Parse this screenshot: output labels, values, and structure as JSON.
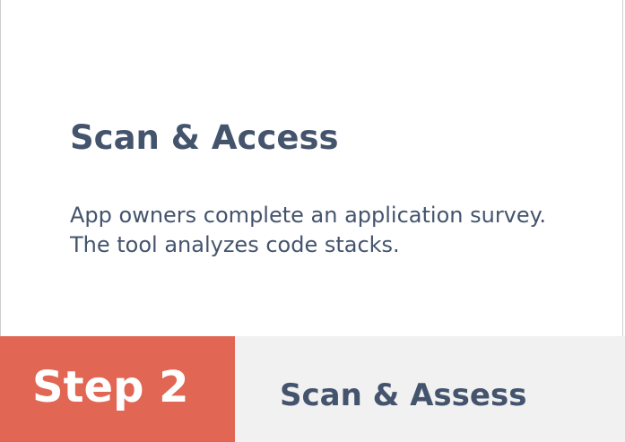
{
  "card": {
    "title": "Scan & Access",
    "description_lines": [
      "App owners complete an application survey.",
      "The tool analyzes code stacks."
    ]
  },
  "step": {
    "label": "Step 2",
    "name": "Scan & Assess"
  },
  "colors": {
    "heading_text": "#44546d",
    "step_badge_bg": "#e16653",
    "step_badge_text": "#ffffff",
    "step_bar_bg": "#f1f1f1",
    "card_border": "#cfcfcf"
  }
}
